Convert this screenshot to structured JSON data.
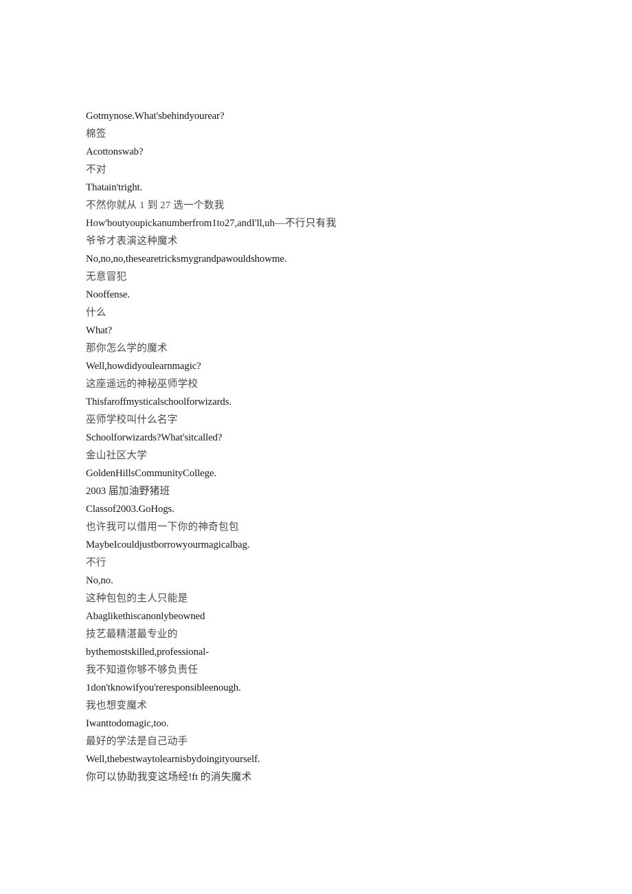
{
  "document": {
    "background_color": "#ffffff",
    "text_color_latin": "#161616",
    "text_color_cjk": "#4a4a4a",
    "lines": [
      {
        "id": "l1",
        "lang": "en",
        "text": "Gotmynose.What'sbehindyourear?"
      },
      {
        "id": "l2",
        "lang": "zh",
        "text": "棉签"
      },
      {
        "id": "l3",
        "lang": "en",
        "text": "Acottonswab?"
      },
      {
        "id": "l4",
        "lang": "zh",
        "text": "不对"
      },
      {
        "id": "l5",
        "lang": "en",
        "text": "Thatain'tright."
      },
      {
        "id": "l6",
        "lang": "zh",
        "text": "不然你就从 1 到 27 选一个数我"
      },
      {
        "id": "l7",
        "lang": "mixed",
        "text": "How'boutyoupickanumberfrom1to27,andI'll,uh—不行只有我"
      },
      {
        "id": "l8",
        "lang": "zh",
        "text": "爷爷才表演这种魔术"
      },
      {
        "id": "l9",
        "lang": "en",
        "text": "No,no,no,thesearetricksmygrandpawouldshowme."
      },
      {
        "id": "l10",
        "lang": "zh",
        "text": "无意冒犯"
      },
      {
        "id": "l11",
        "lang": "en",
        "text": "Nooffense."
      },
      {
        "id": "l12",
        "lang": "zh",
        "text": "什么"
      },
      {
        "id": "l13",
        "lang": "en",
        "text": "What?"
      },
      {
        "id": "l14",
        "lang": "zh",
        "text": "那你怎么学的魔术"
      },
      {
        "id": "l15",
        "lang": "en",
        "text": "Well,howdidyoulearnmagic?"
      },
      {
        "id": "l16",
        "lang": "zh",
        "text": "这座遥远的神秘巫师学校"
      },
      {
        "id": "l17",
        "lang": "en",
        "text": "Thisfaroffmysticalschoolforwizards."
      },
      {
        "id": "l18",
        "lang": "zh",
        "text": "巫师学校叫什么名字"
      },
      {
        "id": "l19",
        "lang": "en",
        "text": "Schoolforwizards?What'sitcalled?"
      },
      {
        "id": "l20",
        "lang": "zh",
        "text": "金山社区大学"
      },
      {
        "id": "l21",
        "lang": "en",
        "text": "GoldenHillsCommunityCollege."
      },
      {
        "id": "l22",
        "lang": "mixed",
        "text": "2003 届加油野猪班"
      },
      {
        "id": "l23",
        "lang": "en",
        "text": "Classof2003.GoHogs."
      },
      {
        "id": "l24",
        "lang": "zh",
        "text": "也许我可以借用一下你的神奇包包"
      },
      {
        "id": "l25",
        "lang": "en",
        "text": "MaybeIcouldjustborrowyourmagicalbag."
      },
      {
        "id": "l26",
        "lang": "zh",
        "text": "不行"
      },
      {
        "id": "l27",
        "lang": "en",
        "text": "No,no."
      },
      {
        "id": "l28",
        "lang": "zh",
        "text": "这种包包的主人只能是"
      },
      {
        "id": "l29",
        "lang": "en",
        "text": "Abaglikethiscanonlybeowned"
      },
      {
        "id": "l30",
        "lang": "zh",
        "text": "技艺最精湛最专业的"
      },
      {
        "id": "l31",
        "lang": "en",
        "text": "bythemostskilled,professional-"
      },
      {
        "id": "l32",
        "lang": "zh",
        "text": "我不知道你够不够负责任"
      },
      {
        "id": "l33",
        "lang": "en",
        "text": "1don'tknowifyou'reresponsibleenough."
      },
      {
        "id": "l34",
        "lang": "zh",
        "text": "我也想变魔术"
      },
      {
        "id": "l35",
        "lang": "en",
        "text": "Iwanttodomagic,too."
      },
      {
        "id": "l36",
        "lang": "zh",
        "text": "最好的学法是自己动手"
      },
      {
        "id": "l37",
        "lang": "en",
        "text": "Well,thebestwaytolearnisbydoingityourself."
      },
      {
        "id": "l38",
        "lang": "mixed",
        "text": "你可以协助我变这场经!ft 的消失魔术"
      }
    ]
  }
}
